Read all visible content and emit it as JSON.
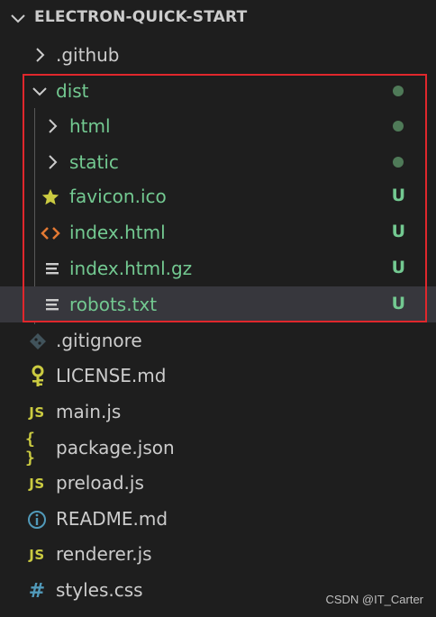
{
  "explorer": {
    "title": "ELECTRON-QUICK-START"
  },
  "tree": {
    "github": {
      "label": ".github",
      "icon": "chevron-right-icon"
    },
    "dist": {
      "label": "dist",
      "icon": "chevron-down-icon"
    },
    "html": {
      "label": "html",
      "icon": "chevron-right-icon"
    },
    "static": {
      "label": "static",
      "icon": "chevron-right-icon"
    },
    "favicon": {
      "label": "favicon.ico",
      "icon": "star-icon",
      "status": "U"
    },
    "index_html": {
      "label": "index.html",
      "icon": "code-icon",
      "status": "U"
    },
    "index_gz": {
      "label": "index.html.gz",
      "icon": "text-file-icon",
      "status": "U"
    },
    "robots": {
      "label": "robots.txt",
      "icon": "text-file-icon",
      "status": "U"
    },
    "gitignore": {
      "label": ".gitignore",
      "icon": "git-icon"
    },
    "license": {
      "label": "LICENSE.md",
      "icon": "key-icon"
    },
    "main": {
      "label": "main.js",
      "icon_text": "JS"
    },
    "package": {
      "label": "package.json",
      "icon_text": "{ }"
    },
    "preload": {
      "label": "preload.js",
      "icon_text": "JS"
    },
    "readme": {
      "label": "README.md",
      "icon": "info-icon"
    },
    "renderer": {
      "label": "renderer.js",
      "icon_text": "JS"
    },
    "styles": {
      "label": "styles.css",
      "icon_text": "#"
    }
  },
  "colors": {
    "background": "#1e1e1e",
    "untracked_green": "#73c991",
    "selected_row": "#37373d",
    "highlight_border": "#e0272c",
    "js_yellow": "#cbcb41",
    "css_blue": "#519aba",
    "html_orange": "#e37933"
  },
  "watermark": {
    "text": "CSDN @IT_Carter"
  }
}
